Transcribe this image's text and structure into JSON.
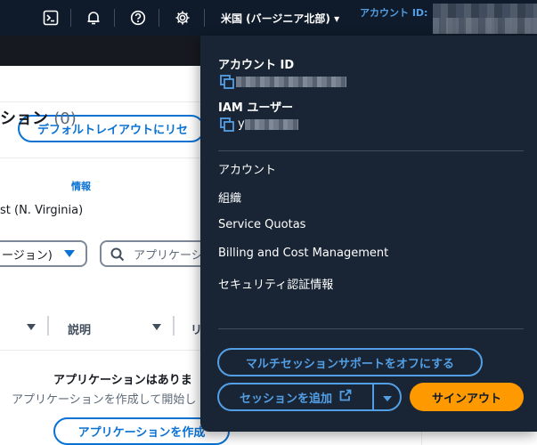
{
  "nav": {
    "region": "米国 (バージニア北部) ▾",
    "account_label": "アカウント ID:",
    "icons": [
      "cloudshell-icon",
      "bell-icon",
      "help-icon",
      "gear-icon"
    ]
  },
  "page": {
    "layout_button": "デフォルトレイアウトにリセ",
    "title": "ション",
    "count": "(0)",
    "info": "情報",
    "region_subtitle": "st (N. Virginia)",
    "select_value": "ージョン)",
    "search_placeholder": "アプリケーシ",
    "col_description": "説明",
    "col_next": "リ",
    "empty_title": "アプリケーションはありま",
    "empty_sub": "アプリケーションを作成して開始し",
    "create_button": "アプリケーションを作成"
  },
  "panel": {
    "account_id_heading": "アカウント ID",
    "iam_user_heading": "IAM ユーザー",
    "iam_user_partial": "y",
    "menu": [
      "アカウント",
      "組織",
      "Service Quotas",
      "Billing and Cost Management",
      "セキュリティ認証情報"
    ],
    "multisession_button": "マルチセッションサポートをオフにする",
    "add_session_button": "セッションを追加",
    "signout_button": "サインアウト"
  },
  "colors": {
    "nav_bg": "#0f1b2a",
    "panel_bg": "#192534",
    "accent_link": "#539fe5",
    "primary_blue": "#0972d3",
    "signout": "#ff9900"
  }
}
